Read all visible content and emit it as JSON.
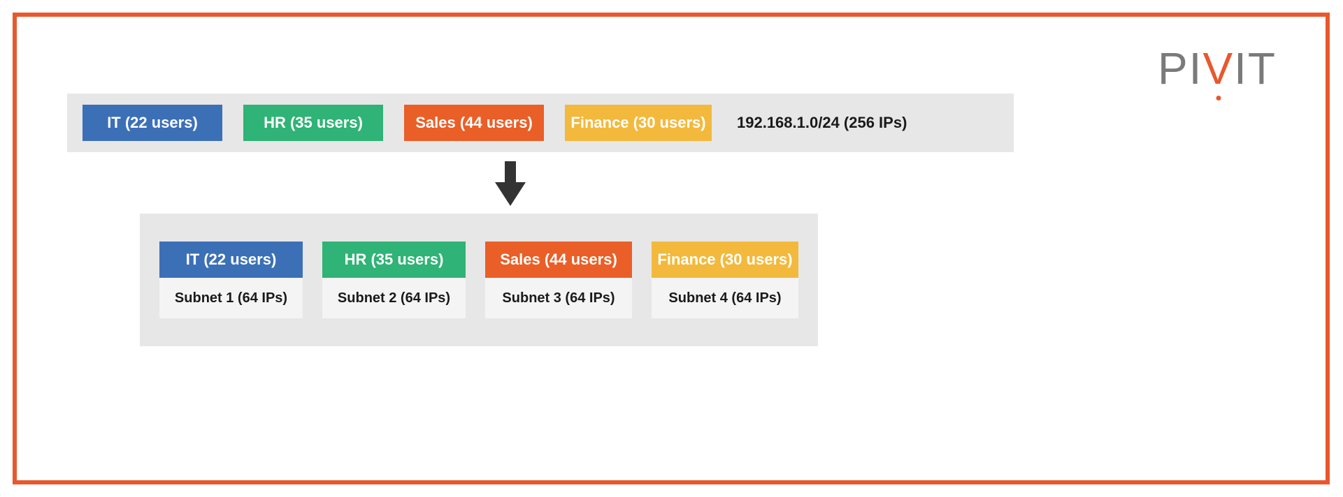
{
  "logo": {
    "part1": "PI",
    "v": "V",
    "part2": "IT"
  },
  "top": {
    "depts": [
      {
        "key": "it",
        "label": "IT (22 users)"
      },
      {
        "key": "hr",
        "label": "HR (35 users)"
      },
      {
        "key": "sales",
        "label": "Sales (44 users)"
      },
      {
        "key": "fin",
        "label": "Finance (30 users)"
      }
    ],
    "network": "192.168.1.0/24 (256 IPs)"
  },
  "bottom": {
    "subnets": [
      {
        "key": "it",
        "dept": "IT (22 users)",
        "subnet": "Subnet 1 (64 IPs)"
      },
      {
        "key": "hr",
        "dept": "HR (35 users)",
        "subnet": "Subnet 2 (64 IPs)"
      },
      {
        "key": "sales",
        "dept": "Sales (44 users)",
        "subnet": "Subnet 3 (64 IPs)"
      },
      {
        "key": "fin",
        "dept": "Finance (30 users)",
        "subnet": "Subnet 4 (64 IPs)"
      }
    ]
  },
  "colors": {
    "accent": "#e8582d",
    "it": "#3c70b6",
    "hr": "#2fb376",
    "sales": "#e95f27",
    "fin": "#f3b93c",
    "panel": "#e7e7e7",
    "light": "#f4f4f4"
  }
}
